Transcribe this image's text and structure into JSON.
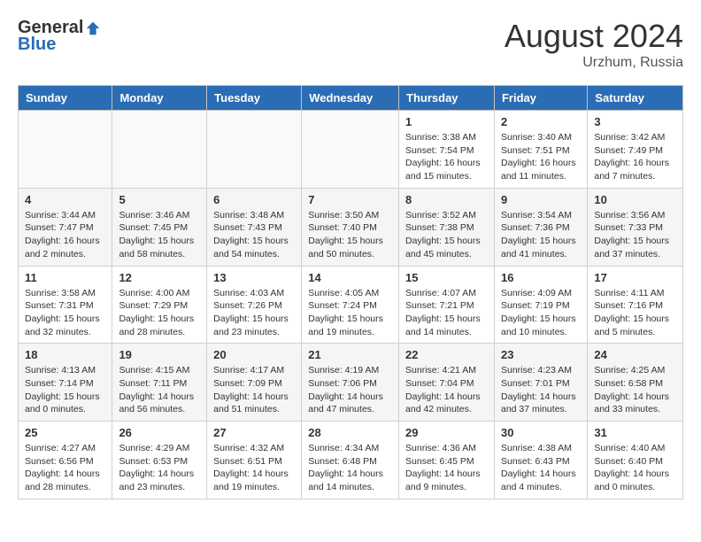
{
  "header": {
    "logo_general": "General",
    "logo_blue": "Blue",
    "month_year": "August 2024",
    "location": "Urzhum, Russia"
  },
  "days_of_week": [
    "Sunday",
    "Monday",
    "Tuesday",
    "Wednesday",
    "Thursday",
    "Friday",
    "Saturday"
  ],
  "weeks": [
    [
      {
        "day": "",
        "info": ""
      },
      {
        "day": "",
        "info": ""
      },
      {
        "day": "",
        "info": ""
      },
      {
        "day": "",
        "info": ""
      },
      {
        "day": "1",
        "info": "Sunrise: 3:38 AM\nSunset: 7:54 PM\nDaylight: 16 hours\nand 15 minutes."
      },
      {
        "day": "2",
        "info": "Sunrise: 3:40 AM\nSunset: 7:51 PM\nDaylight: 16 hours\nand 11 minutes."
      },
      {
        "day": "3",
        "info": "Sunrise: 3:42 AM\nSunset: 7:49 PM\nDaylight: 16 hours\nand 7 minutes."
      }
    ],
    [
      {
        "day": "4",
        "info": "Sunrise: 3:44 AM\nSunset: 7:47 PM\nDaylight: 16 hours\nand 2 minutes."
      },
      {
        "day": "5",
        "info": "Sunrise: 3:46 AM\nSunset: 7:45 PM\nDaylight: 15 hours\nand 58 minutes."
      },
      {
        "day": "6",
        "info": "Sunrise: 3:48 AM\nSunset: 7:43 PM\nDaylight: 15 hours\nand 54 minutes."
      },
      {
        "day": "7",
        "info": "Sunrise: 3:50 AM\nSunset: 7:40 PM\nDaylight: 15 hours\nand 50 minutes."
      },
      {
        "day": "8",
        "info": "Sunrise: 3:52 AM\nSunset: 7:38 PM\nDaylight: 15 hours\nand 45 minutes."
      },
      {
        "day": "9",
        "info": "Sunrise: 3:54 AM\nSunset: 7:36 PM\nDaylight: 15 hours\nand 41 minutes."
      },
      {
        "day": "10",
        "info": "Sunrise: 3:56 AM\nSunset: 7:33 PM\nDaylight: 15 hours\nand 37 minutes."
      }
    ],
    [
      {
        "day": "11",
        "info": "Sunrise: 3:58 AM\nSunset: 7:31 PM\nDaylight: 15 hours\nand 32 minutes."
      },
      {
        "day": "12",
        "info": "Sunrise: 4:00 AM\nSunset: 7:29 PM\nDaylight: 15 hours\nand 28 minutes."
      },
      {
        "day": "13",
        "info": "Sunrise: 4:03 AM\nSunset: 7:26 PM\nDaylight: 15 hours\nand 23 minutes."
      },
      {
        "day": "14",
        "info": "Sunrise: 4:05 AM\nSunset: 7:24 PM\nDaylight: 15 hours\nand 19 minutes."
      },
      {
        "day": "15",
        "info": "Sunrise: 4:07 AM\nSunset: 7:21 PM\nDaylight: 15 hours\nand 14 minutes."
      },
      {
        "day": "16",
        "info": "Sunrise: 4:09 AM\nSunset: 7:19 PM\nDaylight: 15 hours\nand 10 minutes."
      },
      {
        "day": "17",
        "info": "Sunrise: 4:11 AM\nSunset: 7:16 PM\nDaylight: 15 hours\nand 5 minutes."
      }
    ],
    [
      {
        "day": "18",
        "info": "Sunrise: 4:13 AM\nSunset: 7:14 PM\nDaylight: 15 hours\nand 0 minutes."
      },
      {
        "day": "19",
        "info": "Sunrise: 4:15 AM\nSunset: 7:11 PM\nDaylight: 14 hours\nand 56 minutes."
      },
      {
        "day": "20",
        "info": "Sunrise: 4:17 AM\nSunset: 7:09 PM\nDaylight: 14 hours\nand 51 minutes."
      },
      {
        "day": "21",
        "info": "Sunrise: 4:19 AM\nSunset: 7:06 PM\nDaylight: 14 hours\nand 47 minutes."
      },
      {
        "day": "22",
        "info": "Sunrise: 4:21 AM\nSunset: 7:04 PM\nDaylight: 14 hours\nand 42 minutes."
      },
      {
        "day": "23",
        "info": "Sunrise: 4:23 AM\nSunset: 7:01 PM\nDaylight: 14 hours\nand 37 minutes."
      },
      {
        "day": "24",
        "info": "Sunrise: 4:25 AM\nSunset: 6:58 PM\nDaylight: 14 hours\nand 33 minutes."
      }
    ],
    [
      {
        "day": "25",
        "info": "Sunrise: 4:27 AM\nSunset: 6:56 PM\nDaylight: 14 hours\nand 28 minutes."
      },
      {
        "day": "26",
        "info": "Sunrise: 4:29 AM\nSunset: 6:53 PM\nDaylight: 14 hours\nand 23 minutes."
      },
      {
        "day": "27",
        "info": "Sunrise: 4:32 AM\nSunset: 6:51 PM\nDaylight: 14 hours\nand 19 minutes."
      },
      {
        "day": "28",
        "info": "Sunrise: 4:34 AM\nSunset: 6:48 PM\nDaylight: 14 hours\nand 14 minutes."
      },
      {
        "day": "29",
        "info": "Sunrise: 4:36 AM\nSunset: 6:45 PM\nDaylight: 14 hours\nand 9 minutes."
      },
      {
        "day": "30",
        "info": "Sunrise: 4:38 AM\nSunset: 6:43 PM\nDaylight: 14 hours\nand 4 minutes."
      },
      {
        "day": "31",
        "info": "Sunrise: 4:40 AM\nSunset: 6:40 PM\nDaylight: 14 hours\nand 0 minutes."
      }
    ]
  ]
}
